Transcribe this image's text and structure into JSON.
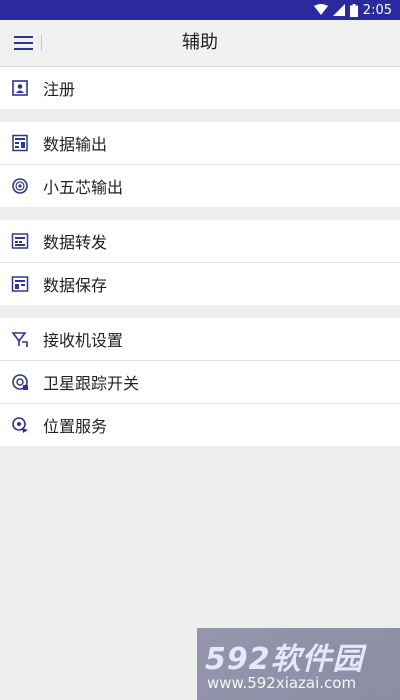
{
  "status_bar": {
    "time": "2:05",
    "icons": [
      "wifi-icon",
      "signal-icon",
      "battery-icon"
    ]
  },
  "app_bar": {
    "title": "辅助",
    "menu_icon": "hamburger-menu-icon"
  },
  "groups": [
    {
      "items": [
        {
          "label": "注册",
          "icon": "contact-card-icon"
        }
      ]
    },
    {
      "items": [
        {
          "label": "数据输出",
          "icon": "data-output-icon"
        },
        {
          "label": "小五芯输出",
          "icon": "connector-icon"
        }
      ]
    },
    {
      "items": [
        {
          "label": "数据转发",
          "icon": "data-forward-icon"
        },
        {
          "label": "数据保存",
          "icon": "data-save-icon"
        }
      ]
    },
    {
      "items": [
        {
          "label": "接收机设置",
          "icon": "receiver-settings-icon"
        },
        {
          "label": "卫星跟踪开关",
          "icon": "satellite-tracking-icon"
        },
        {
          "label": "位置服务",
          "icon": "location-service-icon"
        }
      ]
    }
  ],
  "watermark": {
    "line1": "592软件园",
    "line2": "www.592xiazai.com"
  },
  "colors": {
    "status_bar": "#2a2a9c",
    "icon_accent": "#2f3690",
    "background": "#eeeeee"
  }
}
